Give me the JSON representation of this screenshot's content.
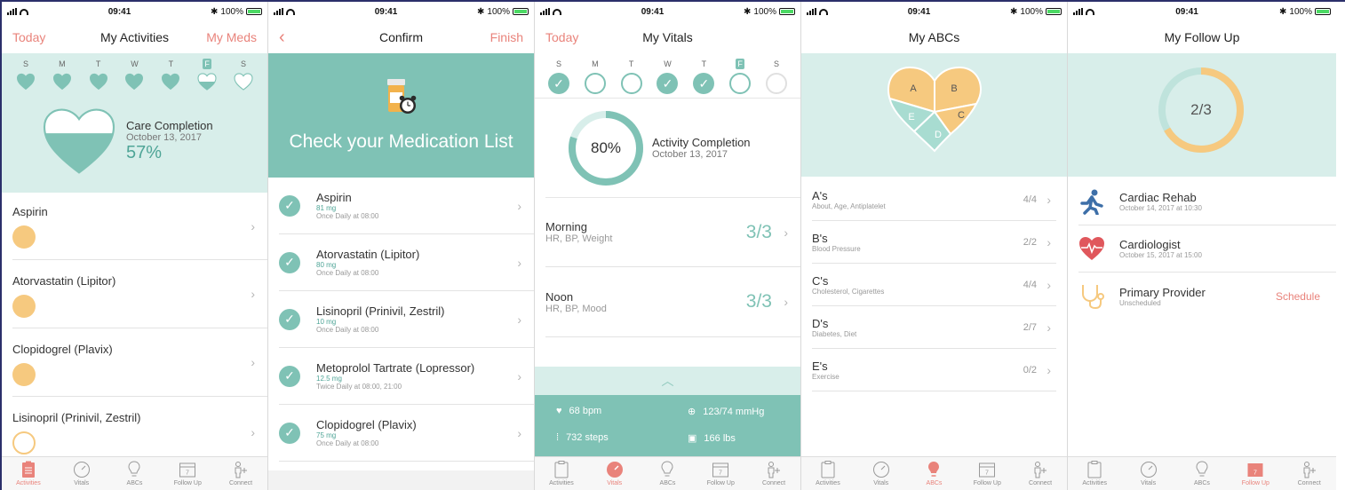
{
  "status": {
    "time": "09:41",
    "battery": "100%"
  },
  "colors": {
    "teal": "#7fc2b5",
    "coral": "#e9837b",
    "gold": "#f6c97f",
    "mint": "#d8eeea"
  },
  "tabs": [
    "Activities",
    "Vitals",
    "ABCs",
    "Follow Up",
    "Connect"
  ],
  "days": [
    "S",
    "M",
    "T",
    "W",
    "T",
    "F",
    "S"
  ],
  "activities": {
    "nav_left": "Today",
    "title": "My Activities",
    "nav_right": "My Meds",
    "care_title": "Care Completion",
    "care_date": "October 13, 2017",
    "care_pct": "57%",
    "meds": [
      "Aspirin",
      "Atorvastatin (Lipitor)",
      "Clopidogrel (Plavix)",
      "Lisinopril (Prinivil, Zestril)"
    ]
  },
  "confirm": {
    "title": "Confirm",
    "nav_right": "Finish",
    "banner": "Check your Medication List",
    "meds": [
      {
        "name": "Aspirin",
        "dose": "81 mg",
        "freq": "Once Daily at 08:00"
      },
      {
        "name": "Atorvastatin (Lipitor)",
        "dose": "80 mg",
        "freq": "Once Daily at 08:00"
      },
      {
        "name": "Lisinopril (Prinivil, Zestril)",
        "dose": "10 mg",
        "freq": "Once Daily at 08:00"
      },
      {
        "name": "Metoprolol Tartrate (Lopressor)",
        "dose": "12.5 mg",
        "freq": "Twice Daily at 08:00, 21:00"
      },
      {
        "name": "Clopidogrel (Plavix)",
        "dose": "75 mg",
        "freq": "Once Daily at 08:00"
      }
    ]
  },
  "vitals": {
    "nav_left": "Today",
    "title": "My Vitals",
    "pct": "80%",
    "pct_value": 0.8,
    "act_title": "Activity Completion",
    "act_date": "October 13, 2017",
    "rows": [
      {
        "name": "Morning",
        "sub": "HR, BP, Weight",
        "val": "3/3"
      },
      {
        "name": "Noon",
        "sub": "HR, BP, Mood",
        "val": "3/3"
      }
    ],
    "hr": "68 bpm",
    "bp": "123/74 mmHg",
    "steps": "732 steps",
    "weight": "166 lbs"
  },
  "abcs": {
    "title": "My ABCs",
    "letters": [
      "A",
      "B",
      "C",
      "D",
      "E"
    ],
    "rows": [
      {
        "name": "A's",
        "sub": "About, Age, Antiplatelet",
        "val": "4/4"
      },
      {
        "name": "B's",
        "sub": "Blood Pressure",
        "val": "2/2"
      },
      {
        "name": "C's",
        "sub": "Cholesterol, Cigarettes",
        "val": "4/4"
      },
      {
        "name": "D's",
        "sub": "Diabetes, Diet",
        "val": "2/7"
      },
      {
        "name": "E's",
        "sub": "Exercise",
        "val": "0/2"
      }
    ]
  },
  "followup": {
    "title": "My Follow Up",
    "progress": "2/3",
    "progress_value": 0.667,
    "items": [
      {
        "name": "Cardiac Rehab",
        "sub": "October 14, 2017 at 10:30",
        "icon": "runner-icon"
      },
      {
        "name": "Cardiologist",
        "sub": "October 15, 2017 at 15:00",
        "icon": "heartbeat-icon"
      },
      {
        "name": "Primary Provider",
        "sub": "Unscheduled",
        "icon": "stethoscope-icon",
        "action": "Schedule"
      }
    ]
  }
}
